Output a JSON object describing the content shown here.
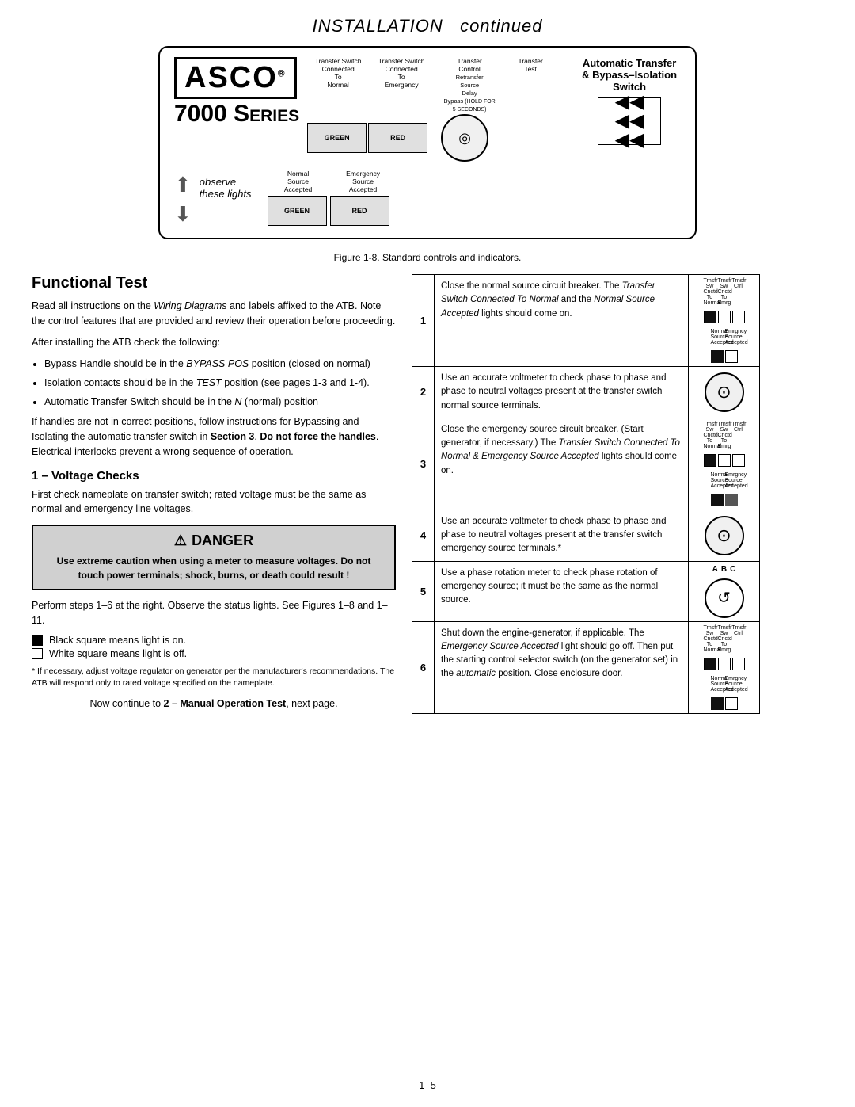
{
  "header": {
    "title": "INSTALLATION",
    "subtitle": "continued"
  },
  "product": {
    "brand": "ASCO",
    "reg_symbol": "®",
    "series_number": "7000",
    "series_label": "Series",
    "product_title_line1": "Automatic Transfer",
    "product_title_line2": "& Bypass–Isolation Switch"
  },
  "controls": {
    "label1": "Transfer Switch Connected To Normal",
    "label2": "Transfer Switch Connected To Emergency",
    "label3_line1": "Transfer",
    "label3_line2": "Control",
    "label3_line3": "Retransfer",
    "label3_line4": "Source",
    "label3_line5": "Delay",
    "label3_line6": "Bypass",
    "label3_hold": "(HOLD FOR 5 SECONDS)",
    "label4": "Transfer Test",
    "green_label": "GREEN",
    "red_label": "RED",
    "observe_label": "observe\nthese lights",
    "normal_source": "Normal\nSource\nAccepted",
    "emergency_source": "Emergency\nSource\nAccepted",
    "green_label2": "GREEN",
    "red_label2": "RED"
  },
  "figure_caption": "Figure 1-8.  Standard controls and indicators.",
  "functional_test": {
    "title": "Functional Test",
    "para1": "Read all instructions on the Wiring Diagrams and labels affixed to the ATB. Note the control features that are provided and review their operation before proceeding.",
    "para2": "After installing the ATB check the following:",
    "bullets": [
      "Bypass Handle should be in the BYPASS POS position (closed on normal)",
      "Isolation contacts should be in the TEST position (see pages 1-3 and 1-4).",
      "Automatic Transfer Switch should be in the N (normal) position"
    ],
    "para3": "If handles are not in correct positions, follow instructions for Bypassing and Isolating the automatic transfer switch in Section 3.  Do not force the handles.  Electrical interlocks prevent a wrong sequence of operation."
  },
  "voltage_checks": {
    "title": "1 – Voltage Checks",
    "para1": "First check nameplate on transfer switch; rated voltage must be the same as normal and emergency line voltages."
  },
  "danger": {
    "header": "DANGER",
    "text": "Use extreme caution when using a meter to measure voltages. Do not touch power terminals; shock, burns, or death could result !"
  },
  "perform_steps": {
    "para1": "Perform steps 1–6 at the right.  Observe the status lights.  See Figures 1–8 and 1–11.",
    "legend": [
      "Black square means light is on.",
      "White square means light is off."
    ]
  },
  "footnote": "* If necessary, adjust voltage regulator on generator per the manufacturer's recommendations. The ATB will respond only to rated voltage specified on the nameplate.",
  "continue_text": "Now continue to 2 – Manual Operation Test, next page.",
  "steps": [
    {
      "num": "1",
      "text": "Close the normal source circuit breaker. The Transfer Switch Connected To Normal and the Normal Source Accepted lights should come on.",
      "has_controls_img": true,
      "has_voltmeter": false,
      "has_phase_meter": false
    },
    {
      "num": "2",
      "text": "Use an accurate voltmeter to check phase to phase and phase to neutral voltages present at the transfer switch normal source terminals.",
      "has_controls_img": false,
      "has_voltmeter": true,
      "has_phase_meter": false
    },
    {
      "num": "3",
      "text": "Close the emergency source circuit breaker. (Start generator, if necessary.) The Transfer Switch Connected To Normal & Emergency Source Accepted lights should come on.",
      "has_controls_img": true,
      "has_voltmeter": false,
      "has_phase_meter": false,
      "step3_variant": true
    },
    {
      "num": "4",
      "text": "Use an accurate voltmeter to check phase to phase and phase to neutral voltages present at the transfer switch emergency source terminals.*",
      "has_controls_img": false,
      "has_voltmeter": true,
      "has_phase_meter": false
    },
    {
      "num": "5",
      "text": "Use a phase rotation meter to check phase rotation of emergency source; it must be the same as the normal source.",
      "has_controls_img": false,
      "has_voltmeter": false,
      "has_phase_meter": true,
      "same_underline": true
    },
    {
      "num": "6",
      "text": "Shut down the engine-generator, if applicable. The Emergency Source Accepted light should go off. Then put the starting control selector switch (on the generator set) in the automatic position. Close enclosure door.",
      "has_controls_img": true,
      "has_voltmeter": false,
      "has_phase_meter": false,
      "step6_variant": true
    }
  ],
  "page_number": "1–5"
}
